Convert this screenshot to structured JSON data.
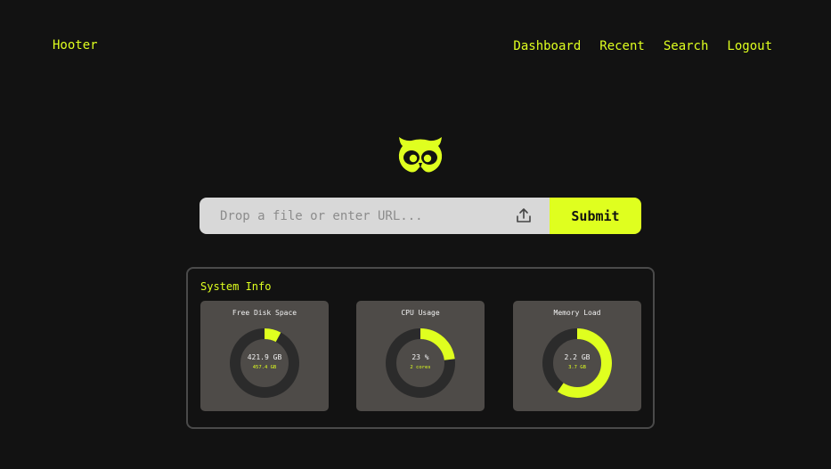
{
  "header": {
    "brand": "Hooter",
    "nav": [
      "Dashboard",
      "Recent",
      "Search",
      "Logout"
    ]
  },
  "upload": {
    "placeholder": "Drop a file or enter URL...",
    "submit_label": "Submit"
  },
  "system_info": {
    "title": "System Info",
    "accent_color": "#dfff1f",
    "track_color": "#2b2b2b",
    "cards": [
      {
        "title": "Free Disk Space",
        "value": "421.9 GB",
        "sub": "457.4 GB",
        "fraction": 0.078
      },
      {
        "title": "CPU Usage",
        "value": "23 %",
        "sub": "2 cores",
        "fraction": 0.23
      },
      {
        "title": "Memory Load",
        "value": "2.2 GB",
        "sub": "3.7 GB",
        "fraction": 0.595
      }
    ]
  },
  "icons": {
    "logo": "owl-logo-icon",
    "upload": "upload-icon"
  }
}
